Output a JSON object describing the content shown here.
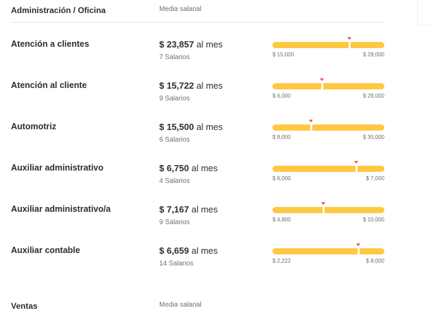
{
  "section": {
    "title": "Administración / Oficina",
    "column_label": "Media salarial"
  },
  "rows": [
    {
      "title": "Atención a clientes",
      "amount": "$ 23,857",
      "period": "al mes",
      "count": "7 Salarios",
      "range_min": "$ 15,000",
      "range_max": "$ 28,000",
      "position": 0.687
    },
    {
      "title": "Atención al cliente",
      "amount": "$ 15,722",
      "period": "al mes",
      "count": "9 Salarios",
      "range_min": "$ 6,000",
      "range_max": "$ 28,000",
      "position": 0.442
    },
    {
      "title": "Automotriz",
      "amount": "$ 15,500",
      "period": "al mes",
      "count": "6 Salarios",
      "range_min": "$ 8,000",
      "range_max": "$ 30,000",
      "position": 0.341
    },
    {
      "title": "Auxiliar administrativo",
      "amount": "$ 6,750",
      "period": "al mes",
      "count": "4 Salarios",
      "range_min": "$ 6,000",
      "range_max": "$ 7,000",
      "position": 0.75
    },
    {
      "title": "Auxiliar administrativo/a",
      "amount": "$ 7,167",
      "period": "al mes",
      "count": "9 Salarios",
      "range_min": "$ 4,800",
      "range_max": "$ 10,000",
      "position": 0.455
    },
    {
      "title": "Auxiliar contable",
      "amount": "$ 6,659",
      "period": "al mes",
      "count": "14 Salarios",
      "range_min": "$ 2,222",
      "range_max": "$ 8,000",
      "position": 0.768
    }
  ],
  "next_section": {
    "title": "Ventas",
    "column_label": "Media salarial"
  },
  "colors": {
    "bar": "#ffc843",
    "marker_triangle": "#e9584a",
    "text": "#2d2d2d",
    "muted": "#6f6f6f"
  }
}
